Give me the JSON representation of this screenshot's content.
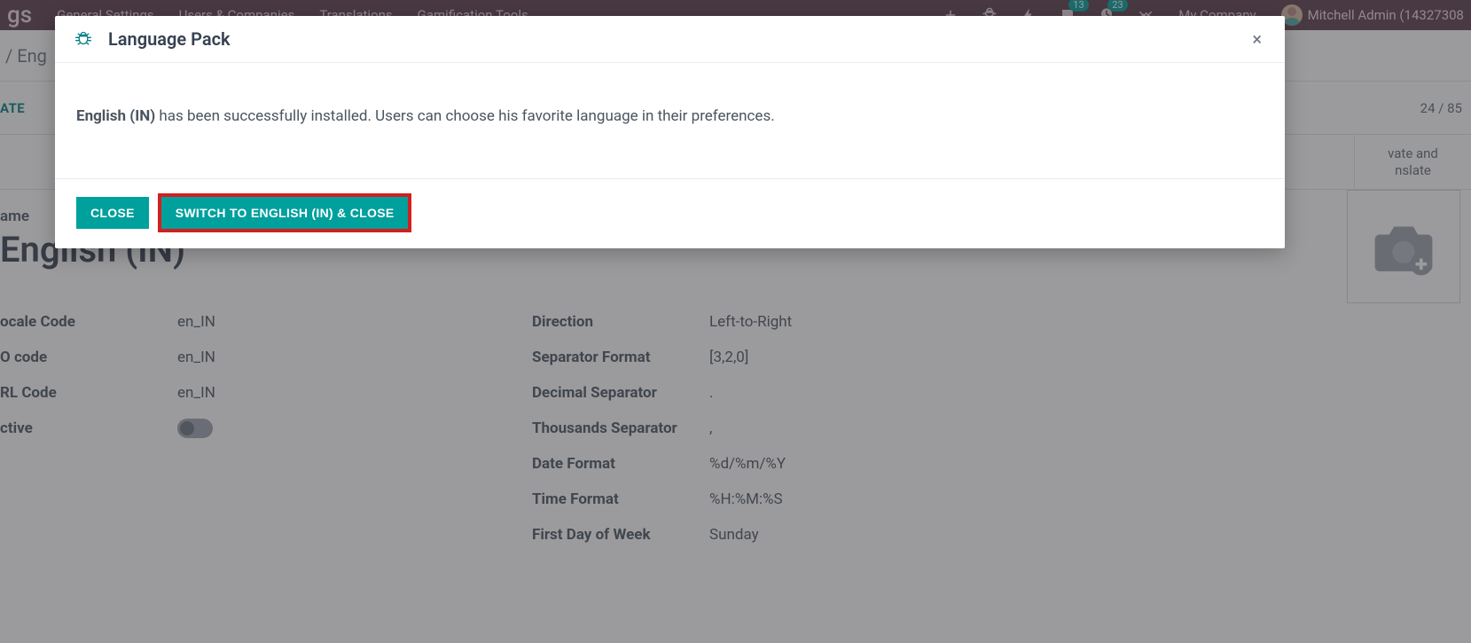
{
  "topnav": {
    "app_title_fragment": "gs",
    "menu": [
      "General Settings",
      "Users & Companies",
      "Translations",
      "Gamification Tools"
    ],
    "badge_conversations": "13",
    "badge_activities": "23",
    "company": "My Company",
    "user": "Mitchell Admin (14327308"
  },
  "breadcrumb": {
    "left_fragment": " / Eng"
  },
  "action": {
    "label_fragment": "ATE",
    "pager": "24 / 85"
  },
  "smart": {
    "button_label": "vate and\nnslate"
  },
  "form": {
    "name_label": "ame",
    "name_value": "English (IN)",
    "left_fields": [
      {
        "label": "ocale Code",
        "value": "en_IN"
      },
      {
        "label": "O code",
        "value": "en_IN"
      },
      {
        "label": "RL Code",
        "value": "en_IN"
      },
      {
        "label": "ctive",
        "value": ""
      }
    ],
    "right_fields": [
      {
        "label": "Direction",
        "value": "Left-to-Right"
      },
      {
        "label": "Separator Format",
        "value": "[3,2,0]"
      },
      {
        "label": "Decimal Separator",
        "value": "."
      },
      {
        "label": "Thousands Separator",
        "value": ","
      },
      {
        "label": "Date Format",
        "value": "%d/%m/%Y"
      },
      {
        "label": "Time Format",
        "value": "%H:%M:%S"
      },
      {
        "label": "First Day of Week",
        "value": "Sunday"
      }
    ]
  },
  "modal": {
    "title": "Language Pack",
    "message_lang": "English (IN)",
    "message_rest": " has been successfully installed. Users can choose his favorite language in their preferences.",
    "close": "CLOSE",
    "switch": "SWITCH TO ENGLISH (IN) & CLOSE",
    "x": "×"
  }
}
